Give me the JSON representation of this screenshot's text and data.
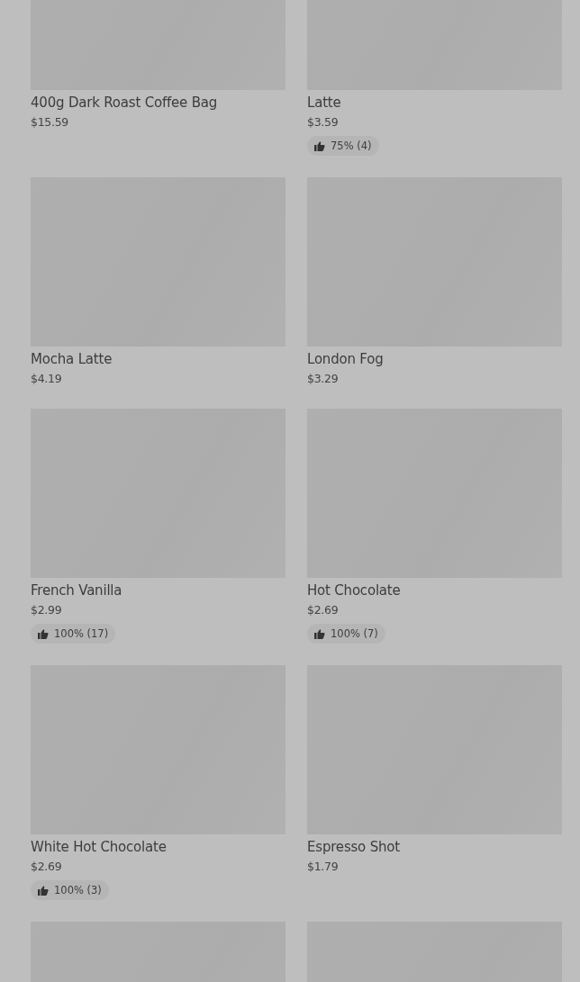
{
  "products": [
    {
      "name": "400g Dark Roast Coffee Bag",
      "price": "$15.59"
    },
    {
      "name": "Latte",
      "price": "$3.59",
      "rating": "75% (4)"
    },
    {
      "name": "Mocha Latte",
      "price": "$4.19"
    },
    {
      "name": "London Fog",
      "price": "$3.29"
    },
    {
      "name": "French Vanilla",
      "price": "$2.99",
      "rating": "100% (17)"
    },
    {
      "name": "Hot Chocolate",
      "price": "$2.69",
      "rating": "100% (7)"
    },
    {
      "name": "White Hot Chocolate",
      "price": "$2.69",
      "rating": "100% (3)"
    },
    {
      "name": "Espresso Shot",
      "price": "$1.79"
    }
  ]
}
